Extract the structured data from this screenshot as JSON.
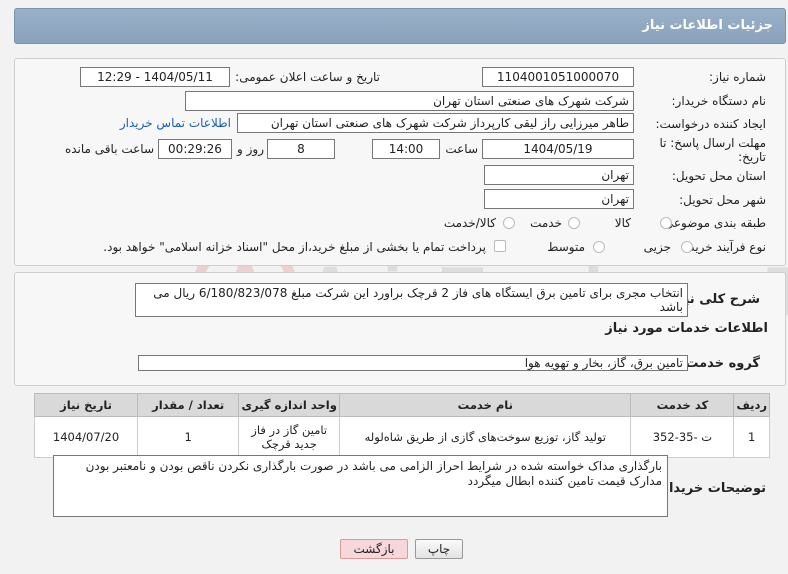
{
  "header": {
    "title": "جزئیات اطلاعات نیاز"
  },
  "need_number": {
    "label": "شماره نیاز:",
    "value": "1104001051000070"
  },
  "announce": {
    "label": "تاریخ و ساعت اعلان عمومی:",
    "value": "1404/05/11 - 12:29"
  },
  "buyer_org": {
    "label": "نام دستگاه خریدار:",
    "value": "شرکت شهرک های صنعتی استان تهران"
  },
  "creator": {
    "label": "ایجاد کننده درخواست:",
    "value": "طاهر  میرزایی راز لیقی کارپرداز شرکت شهرک های صنعتی استان تهران",
    "contact_link": "اطلاعات تماس خریدار"
  },
  "deadline": {
    "label_line1": "مهلت ارسال پاسخ: تا",
    "label_line2": "تاریخ:",
    "date": "1404/05/19",
    "time_label": "ساعت",
    "time": "14:00",
    "days": "8",
    "days_label": "روز و",
    "remaining": "00:29:26",
    "remaining_label": "ساعت باقی مانده"
  },
  "province": {
    "label": "استان محل تحویل:",
    "value": "تهران"
  },
  "city": {
    "label": "شهر محل تحویل:",
    "value": "تهران"
  },
  "category": {
    "label": "طبقه بندی موضوعی:",
    "options": [
      "کالا",
      "خدمت",
      "کالا/خدمت"
    ]
  },
  "process": {
    "label": "نوع فرآیند خرید :",
    "options": [
      "جزیی",
      "متوسط"
    ],
    "payment_note": "پرداخت تمام یا بخشی از مبلغ خرید،از محل \"اسناد خزانه اسلامی\" خواهد بود."
  },
  "description": {
    "label": "شرح کلی نیاز:",
    "value": "انتخاب مجری برای تامین برق ایستگاه های فاز 2 قرچک  براورد این شرکت  مبلغ 6/180/823/078 ریال  می باشد"
  },
  "services_title": "اطلاعات خدمات مورد نیاز",
  "service_group": {
    "label": "گروه خدمت:",
    "value": "تامین برق، گاز، بخار و تهویه هوا"
  },
  "table": {
    "headers": [
      "ردیف",
      "کد خدمت",
      "نام خدمت",
      "واحد اندازه گیری",
      "تعداد / مقدار",
      "تاریخ نیاز"
    ],
    "rows": [
      [
        "1",
        "ت -35-352",
        "تولید گاز، توزیع سوخت‌های گازی از طریق شاه‌لوله",
        "تامین گاز در فاز جدید قرچک",
        "1",
        "1404/07/20"
      ]
    ]
  },
  "buyer_notes": {
    "label": "توضیحات خریدار:",
    "value": "بارگذاری مداک خواسته شده در شرایط احراز الزامی می باشد در صورت بارگذاری نکردن ناقص بودن و نامعتبر بودن مدارک قیمت تامین کننده ابطال میگردد"
  },
  "buttons": {
    "print": "چاپ",
    "back": "بازگشت"
  },
  "watermark": "AriaTender.neT",
  "colors": {
    "header": "#8fa6c0",
    "link": "#1a5fb4",
    "back_button": "#f8d7da"
  }
}
